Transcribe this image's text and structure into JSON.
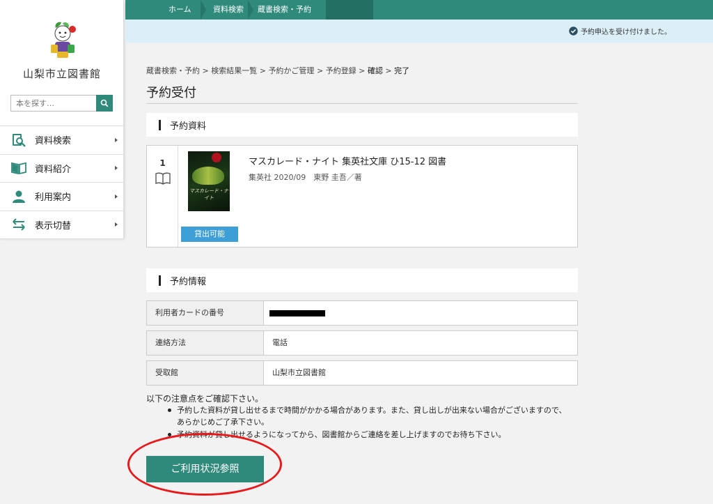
{
  "sidebar": {
    "library_name": "山梨市立図書館",
    "search_placeholder": "本を探す…",
    "nav": [
      {
        "label": "資料検索",
        "icon": "search-book-icon"
      },
      {
        "label": "資料紹介",
        "icon": "open-book-icon"
      },
      {
        "label": "利用案内",
        "icon": "person-icon"
      },
      {
        "label": "表示切替",
        "icon": "swap-arrows-icon"
      }
    ]
  },
  "topbar": {
    "crumbs": [
      "ホーム",
      "資料検索",
      "蔵書検索・予約"
    ]
  },
  "notice": {
    "text": "予約申込を受け付けました。"
  },
  "page": {
    "breadcrumb": {
      "items": [
        "蔵書検索・予約",
        "検索結果一覧",
        "予約かご管理",
        "予約登録",
        "確認",
        "完了"
      ],
      "sep": ">"
    },
    "title": "予約受付",
    "section_item": "予約資料",
    "section_info": "予約情報"
  },
  "item": {
    "number": "1",
    "cover_text": "マスカレード・ナイト",
    "availability": "貸出可能",
    "title": "マスカレード・ナイト 集英社文庫 ひ15-12 図書",
    "meta": "集英社 2020/09　東野 圭吾／著"
  },
  "info": {
    "card_label": "利用者カードの番号",
    "contact_label": "連絡方法",
    "contact_value": "電話",
    "pickup_label": "受取館",
    "pickup_value": "山梨市立図書館"
  },
  "notes": {
    "heading": "以下の注意点をご確認下さい。",
    "items": [
      "予約した資料が貸し出せるまで時間がかかる場合があります。また、貸し出しが出来ない場合がございますので、あらかじめご了承下さい。",
      "予約資料が貸し出せるようになってから、図書館からご連絡を差し上げますのでお待ち下さい。"
    ]
  },
  "button": {
    "status": "ご利用状況参照"
  },
  "colors": {
    "accent": "#2f8a7c",
    "notice_bg": "#dceef8",
    "availability": "#3d9fd6",
    "annotation": "#e8191b"
  }
}
